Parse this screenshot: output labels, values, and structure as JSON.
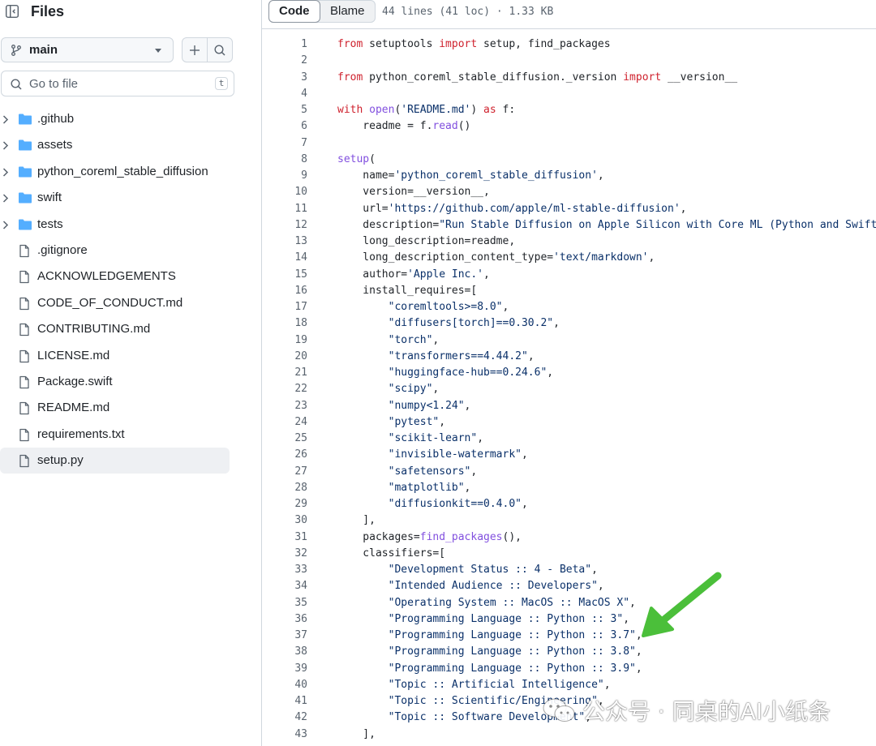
{
  "sidebar": {
    "title": "Files",
    "branch": "main",
    "goto_placeholder": "Go to file",
    "goto_shortcut": "t",
    "items": [
      {
        "name": ".github",
        "type": "folder"
      },
      {
        "name": "assets",
        "type": "folder"
      },
      {
        "name": "python_coreml_stable_diffusion",
        "type": "folder"
      },
      {
        "name": "swift",
        "type": "folder"
      },
      {
        "name": "tests",
        "type": "folder"
      },
      {
        "name": ".gitignore",
        "type": "file"
      },
      {
        "name": "ACKNOWLEDGEMENTS",
        "type": "file"
      },
      {
        "name": "CODE_OF_CONDUCT.md",
        "type": "file"
      },
      {
        "name": "CONTRIBUTING.md",
        "type": "file"
      },
      {
        "name": "LICENSE.md",
        "type": "file"
      },
      {
        "name": "Package.swift",
        "type": "file"
      },
      {
        "name": "README.md",
        "type": "file"
      },
      {
        "name": "requirements.txt",
        "type": "file"
      },
      {
        "name": "setup.py",
        "type": "file",
        "selected": true
      }
    ]
  },
  "toolbar": {
    "code_tab": "Code",
    "blame_tab": "Blame",
    "file_meta": "44 lines (41 loc) · 1.33 KB"
  },
  "code_lines": [
    [
      [
        "kw",
        "from"
      ],
      [
        "p",
        " setuptools "
      ],
      [
        "kw",
        "import"
      ],
      [
        "p",
        " setup, find_packages"
      ]
    ],
    [],
    [
      [
        "kw",
        "from"
      ],
      [
        "p",
        " python_coreml_stable_diffusion._version "
      ],
      [
        "kw",
        "import"
      ],
      [
        "p",
        " __version__"
      ]
    ],
    [],
    [
      [
        "kw",
        "with"
      ],
      [
        "p",
        " "
      ],
      [
        "fn",
        "open"
      ],
      [
        "p",
        "("
      ],
      [
        "str",
        "'README.md'"
      ],
      [
        "p",
        ") "
      ],
      [
        "kw",
        "as"
      ],
      [
        "p",
        " f:"
      ]
    ],
    [
      [
        "p",
        "    readme = f."
      ],
      [
        "fn",
        "read"
      ],
      [
        "p",
        "()"
      ]
    ],
    [],
    [
      [
        "fn",
        "setup"
      ],
      [
        "p",
        "("
      ]
    ],
    [
      [
        "p",
        "    name="
      ],
      [
        "str",
        "'python_coreml_stable_diffusion'"
      ],
      [
        "p",
        ","
      ]
    ],
    [
      [
        "p",
        "    version=__version__,"
      ]
    ],
    [
      [
        "p",
        "    url="
      ],
      [
        "str",
        "'https://github.com/apple/ml-stable-diffusion'"
      ],
      [
        "p",
        ","
      ]
    ],
    [
      [
        "p",
        "    description="
      ],
      [
        "str",
        "\"Run Stable Diffusion on Apple Silicon with Core ML (Python and Swift)\""
      ],
      [
        "p",
        ","
      ]
    ],
    [
      [
        "p",
        "    long_description=readme,"
      ]
    ],
    [
      [
        "p",
        "    long_description_content_type="
      ],
      [
        "str",
        "'text/markdown'"
      ],
      [
        "p",
        ","
      ]
    ],
    [
      [
        "p",
        "    author="
      ],
      [
        "str",
        "'Apple Inc.'"
      ],
      [
        "p",
        ","
      ]
    ],
    [
      [
        "p",
        "    install_requires=["
      ]
    ],
    [
      [
        "p",
        "        "
      ],
      [
        "str",
        "\"coremltools>=8.0\""
      ],
      [
        "p",
        ","
      ]
    ],
    [
      [
        "p",
        "        "
      ],
      [
        "str",
        "\"diffusers[torch]==0.30.2\""
      ],
      [
        "p",
        ","
      ]
    ],
    [
      [
        "p",
        "        "
      ],
      [
        "str",
        "\"torch\""
      ],
      [
        "p",
        ","
      ]
    ],
    [
      [
        "p",
        "        "
      ],
      [
        "str",
        "\"transformers==4.44.2\""
      ],
      [
        "p",
        ","
      ]
    ],
    [
      [
        "p",
        "        "
      ],
      [
        "str",
        "\"huggingface-hub==0.24.6\""
      ],
      [
        "p",
        ","
      ]
    ],
    [
      [
        "p",
        "        "
      ],
      [
        "str",
        "\"scipy\""
      ],
      [
        "p",
        ","
      ]
    ],
    [
      [
        "p",
        "        "
      ],
      [
        "str",
        "\"numpy<1.24\""
      ],
      [
        "p",
        ","
      ]
    ],
    [
      [
        "p",
        "        "
      ],
      [
        "str",
        "\"pytest\""
      ],
      [
        "p",
        ","
      ]
    ],
    [
      [
        "p",
        "        "
      ],
      [
        "str",
        "\"scikit-learn\""
      ],
      [
        "p",
        ","
      ]
    ],
    [
      [
        "p",
        "        "
      ],
      [
        "str",
        "\"invisible-watermark\""
      ],
      [
        "p",
        ","
      ]
    ],
    [
      [
        "p",
        "        "
      ],
      [
        "str",
        "\"safetensors\""
      ],
      [
        "p",
        ","
      ]
    ],
    [
      [
        "p",
        "        "
      ],
      [
        "str",
        "\"matplotlib\""
      ],
      [
        "p",
        ","
      ]
    ],
    [
      [
        "p",
        "        "
      ],
      [
        "str",
        "\"diffusionkit==0.4.0\""
      ],
      [
        "p",
        ","
      ]
    ],
    [
      [
        "p",
        "    ],"
      ]
    ],
    [
      [
        "p",
        "    packages="
      ],
      [
        "fn",
        "find_packages"
      ],
      [
        "p",
        "(),"
      ]
    ],
    [
      [
        "p",
        "    classifiers=["
      ]
    ],
    [
      [
        "p",
        "        "
      ],
      [
        "str",
        "\"Development Status :: 4 - Beta\""
      ],
      [
        "p",
        ","
      ]
    ],
    [
      [
        "p",
        "        "
      ],
      [
        "str",
        "\"Intended Audience :: Developers\""
      ],
      [
        "p",
        ","
      ]
    ],
    [
      [
        "p",
        "        "
      ],
      [
        "str",
        "\"Operating System :: MacOS :: MacOS X\""
      ],
      [
        "p",
        ","
      ]
    ],
    [
      [
        "p",
        "        "
      ],
      [
        "str",
        "\"Programming Language :: Python :: 3\""
      ],
      [
        "p",
        ","
      ]
    ],
    [
      [
        "p",
        "        "
      ],
      [
        "str",
        "\"Programming Language :: Python :: 3.7\""
      ],
      [
        "p",
        ","
      ]
    ],
    [
      [
        "p",
        "        "
      ],
      [
        "str",
        "\"Programming Language :: Python :: 3.8\""
      ],
      [
        "p",
        ","
      ]
    ],
    [
      [
        "p",
        "        "
      ],
      [
        "str",
        "\"Programming Language :: Python :: 3.9\""
      ],
      [
        "p",
        ","
      ]
    ],
    [
      [
        "p",
        "        "
      ],
      [
        "str",
        "\"Topic :: Artificial Intelligence\""
      ],
      [
        "p",
        ","
      ]
    ],
    [
      [
        "p",
        "        "
      ],
      [
        "str",
        "\"Topic :: Scientific/Engineering\""
      ],
      [
        "p",
        ","
      ]
    ],
    [
      [
        "p",
        "        "
      ],
      [
        "str",
        "\"Topic :: Software Development\""
      ],
      [
        "p",
        ","
      ]
    ],
    [
      [
        "p",
        "    ],"
      ]
    ]
  ],
  "watermark": {
    "text": "公众号 · 同桌的AI小纸条"
  },
  "colors": {
    "keyword": "#cf222e",
    "string": "#0a3069",
    "function": "#8250df",
    "folder": "#54aeff",
    "arrow": "#4bbf3a"
  },
  "icons": {
    "sidebar_toggle": "sidebar-collapse-icon",
    "branch": "git-branch-icon",
    "add": "plus-icon",
    "search": "search-icon",
    "folder": "folder-icon",
    "file": "file-icon",
    "chevron": "chevron-right-icon",
    "annotation": "green-arrow-icon",
    "wechat": "wechat-icon"
  }
}
